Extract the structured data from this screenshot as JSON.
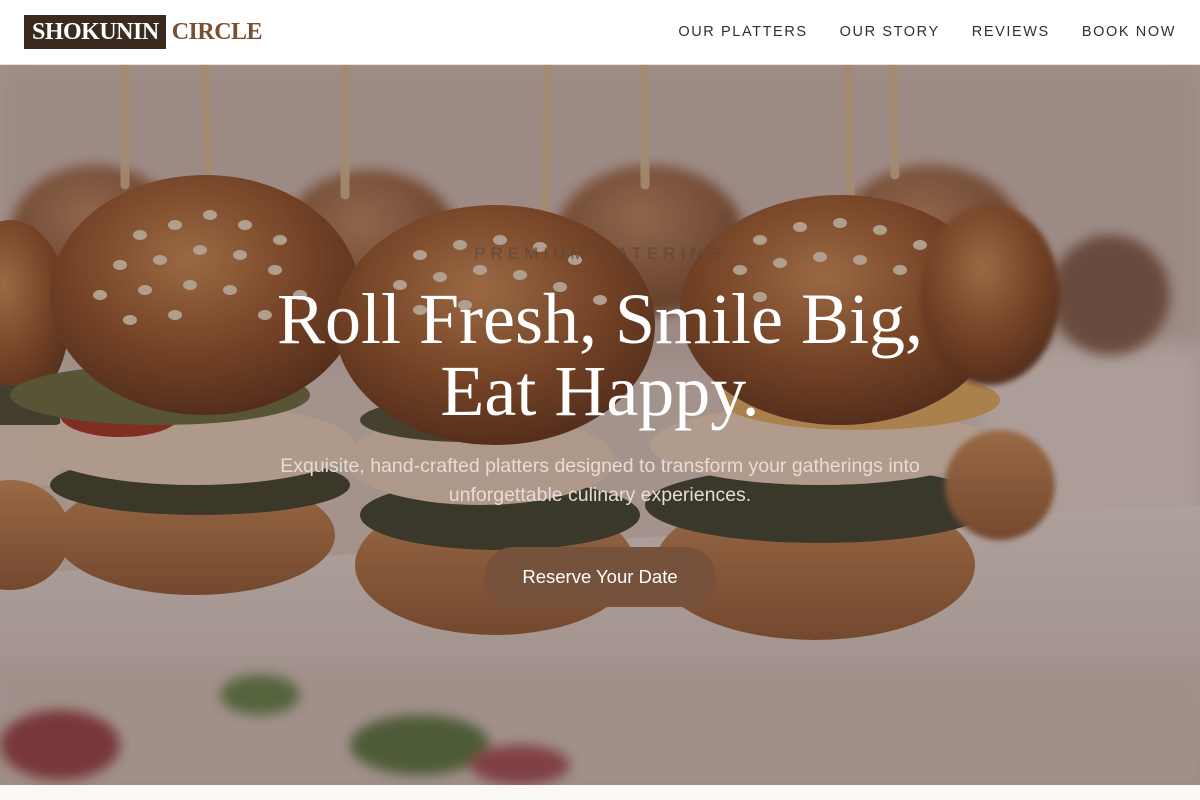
{
  "brand": {
    "name_boxed": "SHOKUNIN",
    "name_rest": "CIRCLE",
    "colors": {
      "dark": "#3b2a20",
      "accent": "#7a4f34",
      "button": "#76523d"
    }
  },
  "nav": {
    "items": [
      {
        "label": "OUR PLATTERS"
      },
      {
        "label": "OUR STORY"
      },
      {
        "label": "REVIEWS"
      },
      {
        "label": "BOOK NOW"
      }
    ]
  },
  "hero": {
    "eyebrow": "PREMIUM CATERING",
    "headline_line1": "Roll Fresh, Smile Big,",
    "headline_line2": "Eat Happy.",
    "subtitle": "Exquisite, hand-crafted platters designed to transform your gatherings into unforgettable culinary experiences.",
    "cta_label": "Reserve Your Date",
    "background_image": "slider-burgers-photo"
  }
}
